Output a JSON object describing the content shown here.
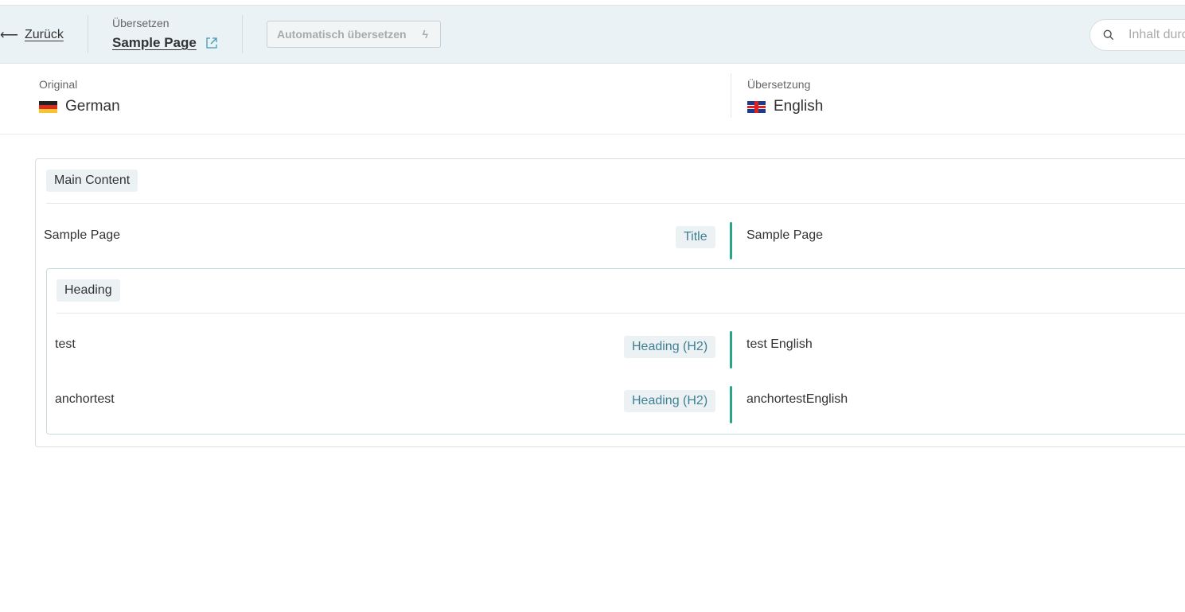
{
  "header": {
    "back_label": "Zurück",
    "crumb_label": "Übersetzen",
    "page_title": "Sample Page",
    "auto_translate_label": "Automatisch übersetzen",
    "search_placeholder": "Inhalt durchsuchen"
  },
  "languages": {
    "original_label": "Original",
    "original_name": "German",
    "translation_label": "Übersetzung",
    "translation_name": "English"
  },
  "sections": [
    {
      "title": "Main Content",
      "rows": [
        {
          "source": "Sample Page",
          "type": "Title",
          "target": "Sample Page"
        }
      ]
    },
    {
      "title": "Heading",
      "rows": [
        {
          "source": "test",
          "type": "Heading (H2)",
          "target": "test English"
        },
        {
          "source": "anchortest",
          "type": "Heading (H2)",
          "target": "anchortestEnglish"
        }
      ]
    }
  ],
  "colors": {
    "header_bg": "#eaf2f5",
    "accent": "#2aa58a",
    "type_text": "#3f7f93"
  }
}
